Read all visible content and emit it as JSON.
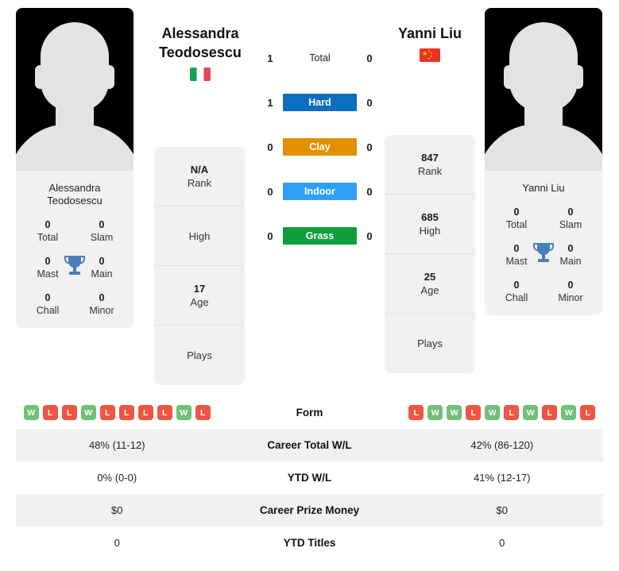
{
  "players": {
    "left": {
      "name": "Alessandra Teodosescu",
      "name_line1": "Alessandra",
      "name_line2": "Teodosescu",
      "card_name": "Alessandra Teodosescu",
      "flag": "it-flag-icon",
      "avatar": "player-photo-placeholder",
      "trophies": [
        {
          "value": "0",
          "label": "Total"
        },
        {
          "value": "0",
          "label": "Slam"
        },
        {
          "value": "0",
          "label": "Mast"
        },
        {
          "value": "0",
          "label": "Main"
        },
        {
          "value": "0",
          "label": "Chall"
        },
        {
          "value": "0",
          "label": "Minor"
        }
      ],
      "info": [
        {
          "value": "N/A",
          "label": "Rank"
        },
        {
          "value": "",
          "label": "High"
        },
        {
          "value": "17",
          "label": "Age"
        },
        {
          "value": "",
          "label": "Plays"
        }
      ],
      "form": [
        "W",
        "L",
        "L",
        "W",
        "L",
        "L",
        "L",
        "L",
        "W",
        "L"
      ]
    },
    "right": {
      "name": "Yanni Liu",
      "card_name": "Yanni Liu",
      "flag": "cn-flag-icon",
      "avatar": "player-photo-placeholder",
      "trophies": [
        {
          "value": "0",
          "label": "Total"
        },
        {
          "value": "0",
          "label": "Slam"
        },
        {
          "value": "0",
          "label": "Mast"
        },
        {
          "value": "0",
          "label": "Main"
        },
        {
          "value": "0",
          "label": "Chall"
        },
        {
          "value": "0",
          "label": "Minor"
        }
      ],
      "info": [
        {
          "value": "847",
          "label": "Rank"
        },
        {
          "value": "685",
          "label": "High"
        },
        {
          "value": "25",
          "label": "Age"
        },
        {
          "value": "",
          "label": "Plays"
        }
      ],
      "form": [
        "L",
        "W",
        "W",
        "L",
        "W",
        "L",
        "W",
        "L",
        "W",
        "L"
      ]
    }
  },
  "h2h": {
    "rows": [
      {
        "left": "1",
        "label": "Total",
        "right": "0",
        "color": "transparent"
      },
      {
        "left": "1",
        "label": "Hard",
        "right": "0",
        "color": "#0d6ec0"
      },
      {
        "left": "0",
        "label": "Clay",
        "right": "0",
        "color": "#e09000"
      },
      {
        "left": "0",
        "label": "Indoor",
        "right": "0",
        "color": "#2f9ef5"
      },
      {
        "left": "0",
        "label": "Grass",
        "right": "0",
        "color": "#0f9e3e"
      }
    ]
  },
  "stats_table": {
    "form_label": "Form",
    "rows": [
      {
        "left": "48% (11-12)",
        "label": "Career Total W/L",
        "right": "42% (86-120)"
      },
      {
        "left": "0% (0-0)",
        "label": "YTD W/L",
        "right": "41% (12-17)"
      },
      {
        "left": "$0",
        "label": "Career Prize Money",
        "right": "$0"
      },
      {
        "left": "0",
        "label": "YTD Titles",
        "right": "0"
      }
    ]
  },
  "colors": {
    "win": "#72bf77",
    "loss": "#ef5543",
    "hard": "#0d6ec0",
    "clay": "#e09000",
    "indoor": "#2f9ef5",
    "grass": "#0f9e3e",
    "card_bg": "#f1f1f1",
    "trophy": "#4a7ebb"
  }
}
